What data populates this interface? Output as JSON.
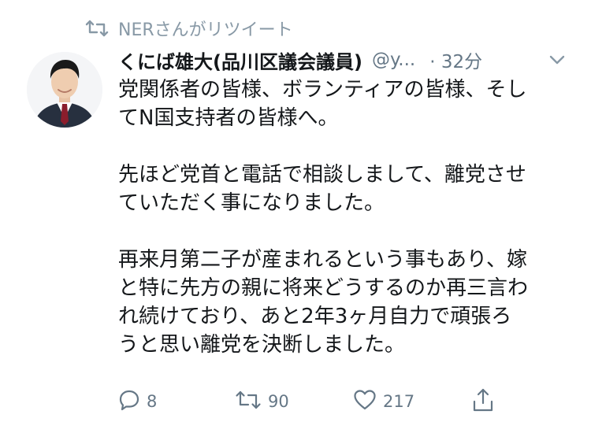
{
  "retweet_context": {
    "icon": "retweet-icon",
    "text": "NERさんがリツイート"
  },
  "tweet": {
    "author": {
      "avatar": "profile-photo",
      "display_name": "くにば雄大(品川区議会議員)",
      "handle": "@y...",
      "time": "· 32分"
    },
    "paragraphs": [
      [
        "党関係者の皆様、ボランティアの皆様、そし",
        "てN国支持者の皆様へ。"
      ],
      [
        "先ほど党首と電話で相談しまして、離党させ",
        "ていただく事になりました。"
      ],
      [
        "再来月第二子が産まれるという事もあり、嫁",
        "と特に先方の親に将来どうするのか再三言わ",
        "れ続けており、あと2年3ヶ月自力で頑張ろ",
        "うと思い離党を決断しました。"
      ]
    ]
  },
  "actions": {
    "reply_count": "8",
    "retweet_count": "90",
    "like_count": "217"
  },
  "colors": {
    "text": "#14171a",
    "secondary": "#657786",
    "context": "#8899a6"
  }
}
